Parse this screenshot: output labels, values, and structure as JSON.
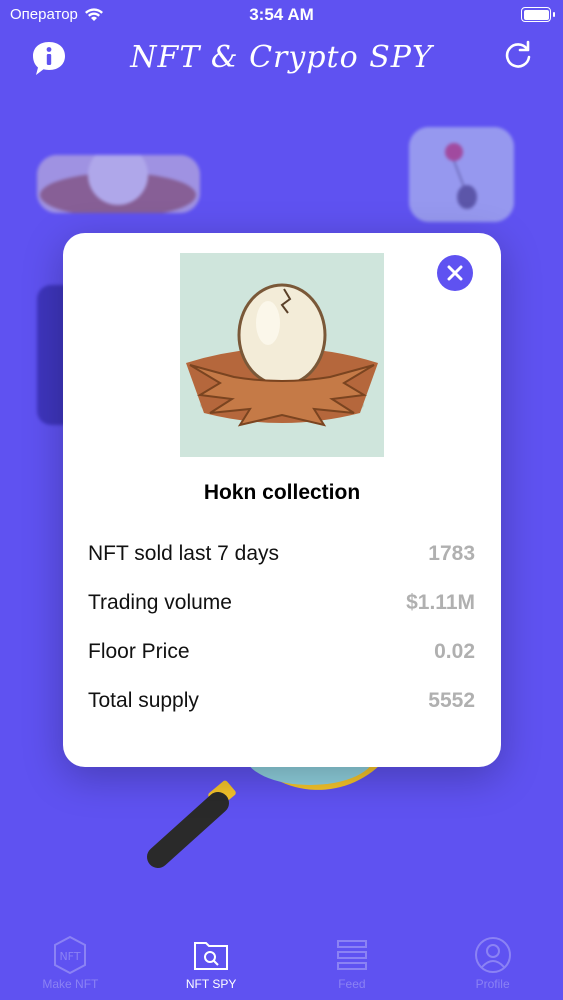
{
  "status_bar": {
    "carrier": "Оператор",
    "time": "3:54 AM"
  },
  "header": {
    "title": "NFT & Crypto SPY"
  },
  "modal": {
    "collection_name": "Hokn collection",
    "stats": [
      {
        "label": "NFT sold last 7 days",
        "value": "1783"
      },
      {
        "label": "Trading volume",
        "value": "$1.11M"
      },
      {
        "label": "Floor Price",
        "value": "0.02"
      },
      {
        "label": "Total supply",
        "value": "5552"
      }
    ]
  },
  "tabs": [
    {
      "label": "Make NFT",
      "icon": "nft-badge-icon",
      "active": false
    },
    {
      "label": "NFT SPY",
      "icon": "folder-search-icon",
      "active": true
    },
    {
      "label": "Feed",
      "icon": "feed-icon",
      "active": false
    },
    {
      "label": "Profile",
      "icon": "profile-icon",
      "active": false
    }
  ],
  "colors": {
    "background": "#5f52f1",
    "accent": "#5f52f1",
    "stat_value": "#b0b0b0"
  }
}
